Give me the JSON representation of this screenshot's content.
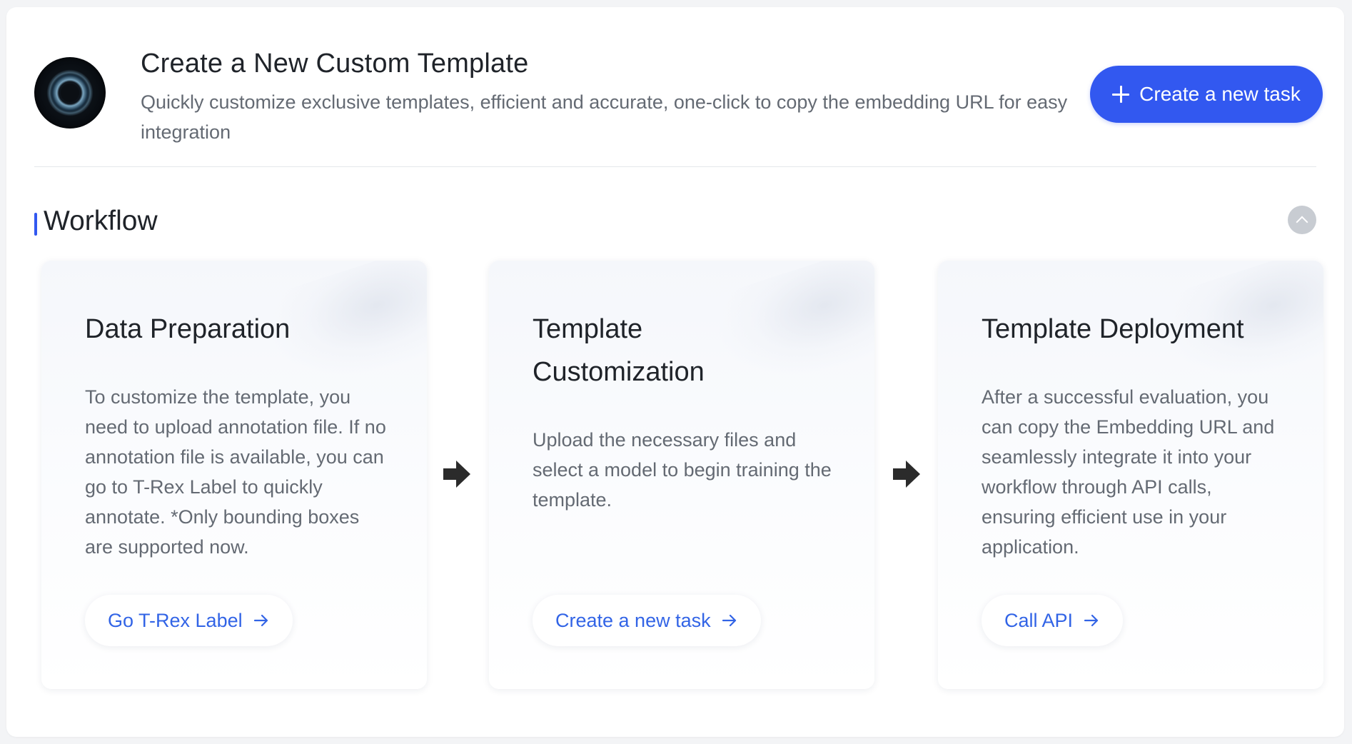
{
  "header": {
    "title": "Create a New Custom Template",
    "subtitle": "Quickly customize exclusive templates, efficient and accurate, one-click to copy the embedding URL for easy integration",
    "new_task_button": "Create a new task",
    "logo_icon": "logo-icon",
    "plus_icon": "plus-icon"
  },
  "workflow": {
    "title": "Workflow",
    "collapse_icon": "chevron-up-icon",
    "flow_arrow_icon": "arrow-right-solid-icon",
    "cards": [
      {
        "title": "Data Preparation",
        "description": "To customize the template, you need to upload annotation file. If no annotation file is available, you can go to T-Rex Label to quickly annotate. *Only bounding boxes are supported now.",
        "link_label": "Go T-Rex Label"
      },
      {
        "title": "Template Customization",
        "description": "Upload the necessary files and select a model to begin training the template.",
        "link_label": "Create a new task"
      },
      {
        "title": "Template Deployment",
        "description": "After a successful evaluation, you can copy the Embedding URL and seamlessly integrate it into your workflow through API calls, ensuring efficient use in your application.",
        "link_label": "Call API"
      }
    ]
  },
  "colors": {
    "primary": "#3258f0",
    "link": "#3264e6",
    "text": "#1f2329",
    "muted_text": "#646a73",
    "arrow": "#2b2b2b"
  }
}
